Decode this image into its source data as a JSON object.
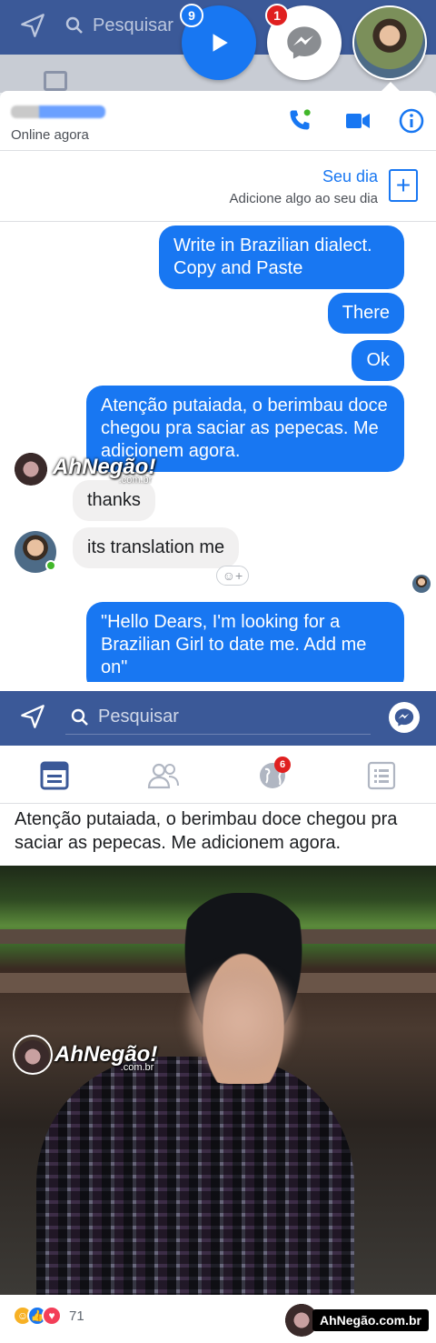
{
  "messenger": {
    "search_placeholder": "Pesquisar",
    "chat_heads": {
      "video_badge": "9",
      "messenger_badge": "1"
    },
    "contact_status": "Online agora",
    "story": {
      "title": "Seu dia",
      "subtitle": "Adicione algo ao seu dia"
    },
    "messages": [
      {
        "from": "me",
        "text": "Write in Brazilian dialect. Copy and Paste"
      },
      {
        "from": "me",
        "text": "There"
      },
      {
        "from": "me",
        "text": "Ok"
      },
      {
        "from": "me",
        "text": "Atenção putaiada, o berimbau doce chegou pra saciar as pepecas. Me adicionem agora."
      },
      {
        "from": "them",
        "text": "thanks"
      },
      {
        "from": "them",
        "text": "its translation me"
      },
      {
        "from": "me",
        "text": "\"Hello Dears, I'm looking for a Brazilian Girl to date me. Add me on\""
      }
    ],
    "watermark": {
      "brand": "AhNegão!",
      "domain": ".com.br"
    }
  },
  "facebook": {
    "search_placeholder": "Pesquisar",
    "notification_count": "6",
    "post_text": "Atenção putaiada, o berimbau doce chegou pra saciar as pepecas. Me adicionem agora.",
    "reaction_count": "71",
    "watermark": {
      "brand": "AhNegão!",
      "domain": ".com.br"
    },
    "site_label": "AhNegão.com.br"
  },
  "colors": {
    "fb_blue": "#3b5998",
    "messenger_blue": "#1877f2",
    "badge_red": "#e02020",
    "online_green": "#42b72a"
  }
}
